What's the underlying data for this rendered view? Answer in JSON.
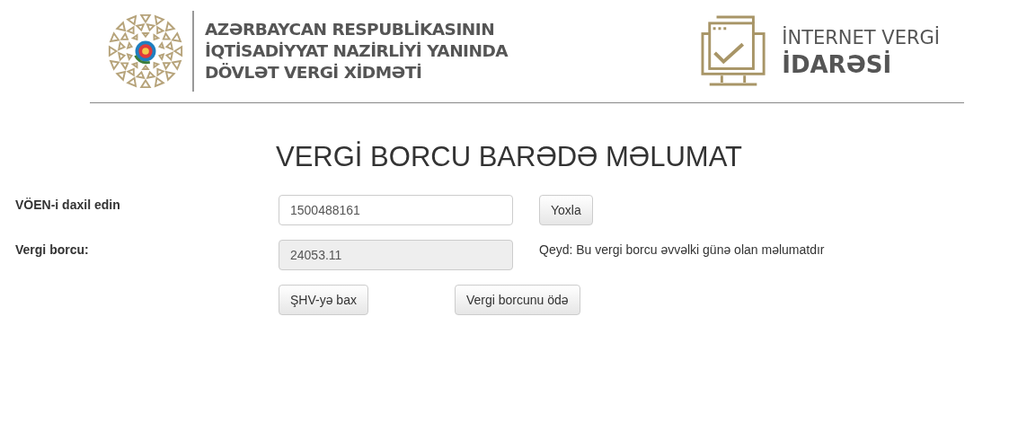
{
  "header": {
    "agency_lines": [
      "AZƏRBAYCAN RESPUBLİKASININ",
      "İQTİSADİYYAT NAZİRLİYİ YANINDA",
      "DÖVLƏT VERGİ XİDMƏTİ"
    ],
    "portal_lines": [
      "İNTERNET VERGİ",
      "İDARƏSİ"
    ]
  },
  "title": "VERGİ BORCU BARƏDƏ MƏLUMAT",
  "form": {
    "rows": [
      {
        "label": "VÖEN-i daxil edin",
        "field": {
          "value": "1500488161",
          "disabled": false
        },
        "button": "Yoxla"
      },
      {
        "label": "Vergi borcu:",
        "field": {
          "value": "24053.11",
          "disabled": true
        },
        "note": "Qeyd: Bu vergi borcu əvvəlki günə olan məlumatdır"
      }
    ],
    "actions": [
      "ŞHV-yə bax",
      "Vergi borcunu ödə"
    ]
  }
}
